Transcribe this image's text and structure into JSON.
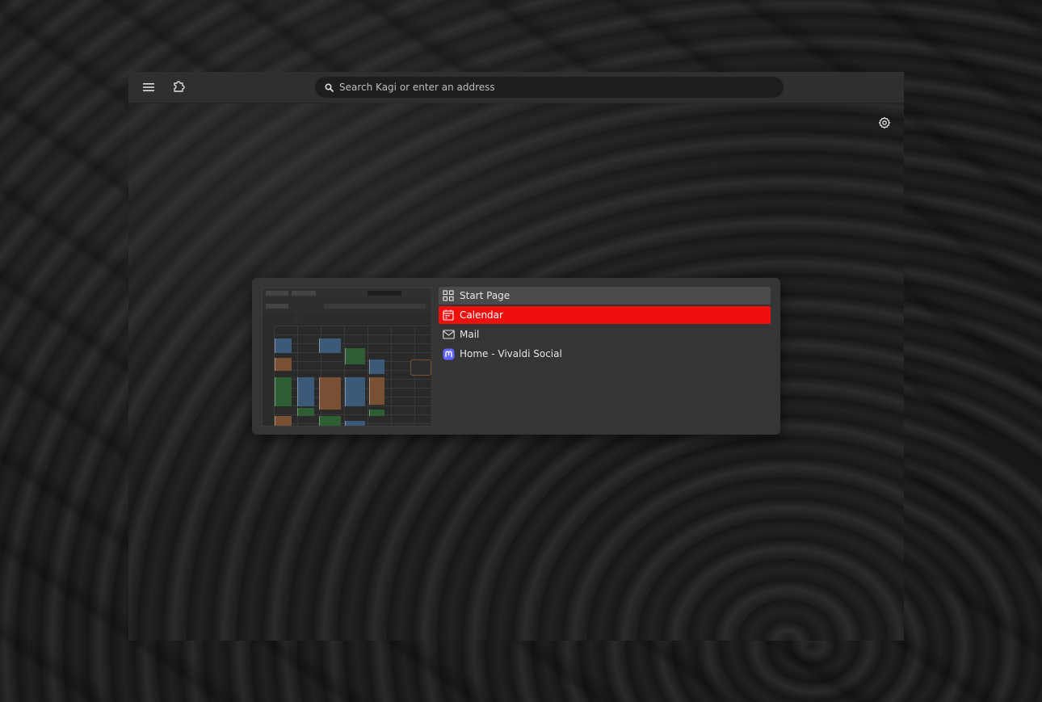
{
  "toolbar": {
    "menu_icon": "hamburger-menu-icon",
    "extensions_icon": "puzzle-extension-icon",
    "search_icon": "search-icon",
    "address_placeholder": "Search Kagi or enter an address"
  },
  "page": {
    "settings_icon": "gear-icon"
  },
  "tab_switcher": {
    "tabs": [
      {
        "label": "Start Page",
        "icon": "grid-icon",
        "state": "hover"
      },
      {
        "label": "Calendar",
        "icon": "calendar-icon",
        "state": "active"
      },
      {
        "label": "Mail",
        "icon": "mail-icon",
        "state": "normal"
      },
      {
        "label": "Home - Vivaldi Social",
        "icon": "mastodon-icon",
        "state": "normal"
      }
    ]
  },
  "colors": {
    "active_tab": "#ef0f0f",
    "hover_tab": "#4a4a4a",
    "switcher_bg": "#353535",
    "toolbar_bg": "#2f2f2f",
    "mastodon_purple": "#6364ff"
  }
}
